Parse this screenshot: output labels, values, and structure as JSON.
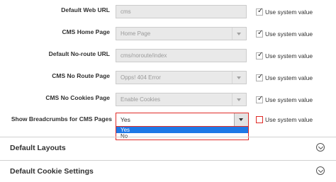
{
  "rows": [
    {
      "label": "Default Web URL",
      "value": "cms",
      "use_system_value": "Use system value"
    },
    {
      "label": "CMS Home Page",
      "value": "Home Page",
      "use_system_value": "Use system value"
    },
    {
      "label": "Default No-route URL",
      "value": "cms/noroute/index",
      "use_system_value": "Use system value"
    },
    {
      "label": "CMS No Route Page",
      "value": "Opps! 404 Error",
      "use_system_value": "Use system value"
    },
    {
      "label": "CMS No Cookies Page",
      "value": "Enable Cookies",
      "use_system_value": "Use system value"
    }
  ],
  "breadcrumbs": {
    "label": "Show Breadcrumbs for CMS Pages",
    "selected": "Yes",
    "options": [
      "Yes",
      "No"
    ],
    "highlighted": "Yes",
    "use_system_value": "Use system value",
    "use_system_checked": false
  },
  "sections": [
    {
      "title": "Default Layouts"
    },
    {
      "title": "Default Cookie Settings"
    }
  ],
  "colors": {
    "highlight": "#1e78e6",
    "error_border": "#e02b27"
  }
}
